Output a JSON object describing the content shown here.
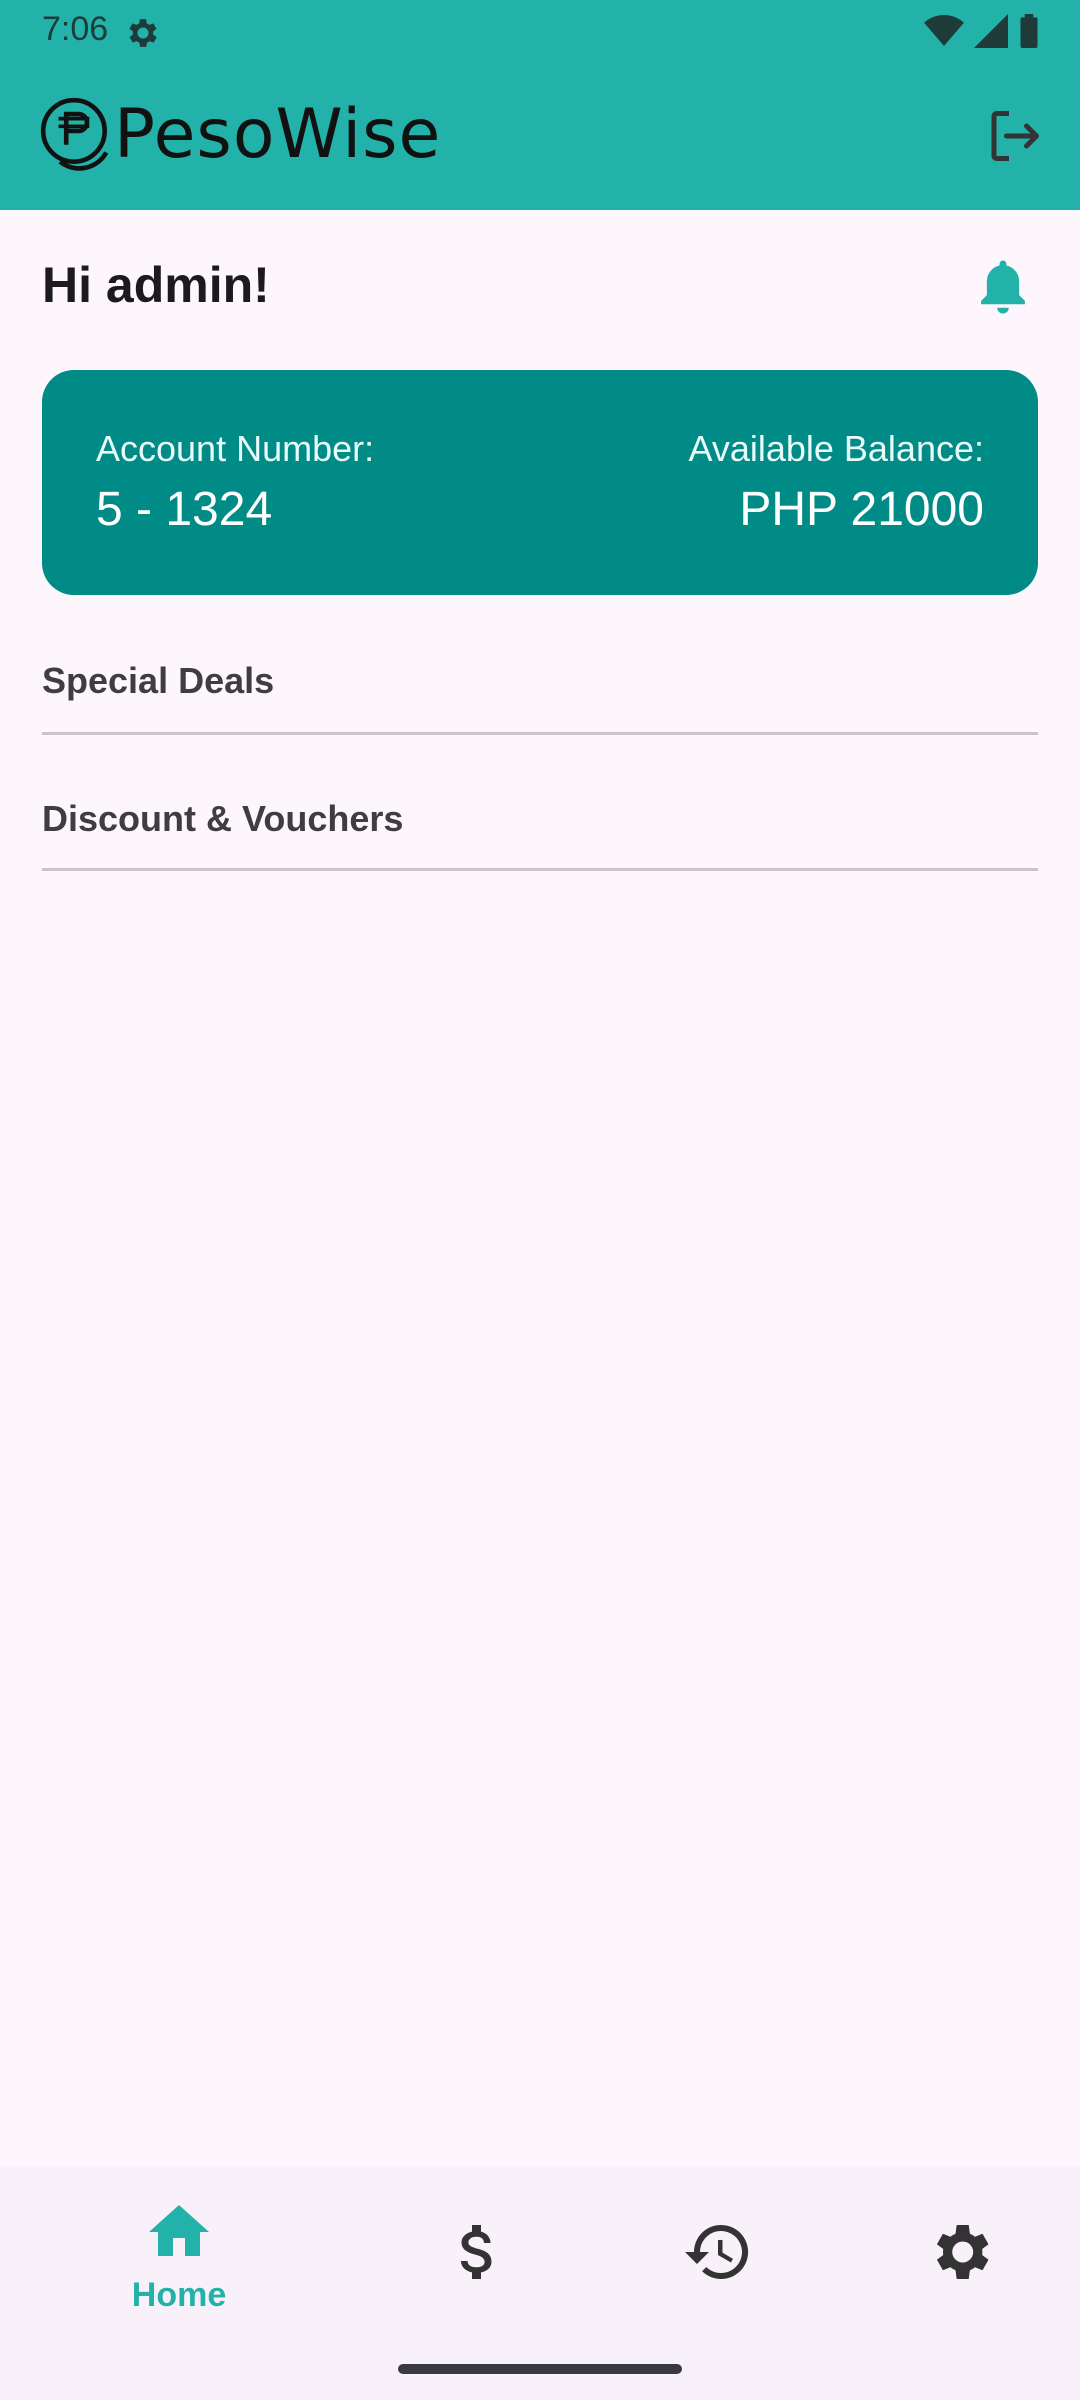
{
  "status_bar": {
    "time": "7:06",
    "icons": [
      "settings-gear-icon",
      "wifi-icon",
      "signal-icon",
      "battery-icon"
    ]
  },
  "app_bar": {
    "logo_text": "PesoWise",
    "logo_icon": "peso-coin-icon",
    "logout_icon": "logout-icon"
  },
  "greeting": "Hi admin!",
  "notification_icon": "bell-icon",
  "account_card": {
    "account_label": "Account Number:",
    "account_value": "5 - 1324",
    "balance_label": "Available Balance:",
    "balance_value": "PHP 21000"
  },
  "sections": [
    {
      "title": "Special Deals"
    },
    {
      "title": "Discount & Vouchers"
    }
  ],
  "bottom_nav": {
    "items": [
      {
        "label": "Home",
        "icon": "home-icon",
        "active": true
      },
      {
        "label": "",
        "icon": "dollar-icon",
        "active": false
      },
      {
        "label": "",
        "icon": "history-icon",
        "active": false
      },
      {
        "label": "",
        "icon": "gear-icon",
        "active": false
      }
    ]
  },
  "colors": {
    "brand_teal": "#22b2aa",
    "card_teal": "#008b87",
    "background": "#fdf7fd",
    "text_dark": "#1b1b1f"
  }
}
